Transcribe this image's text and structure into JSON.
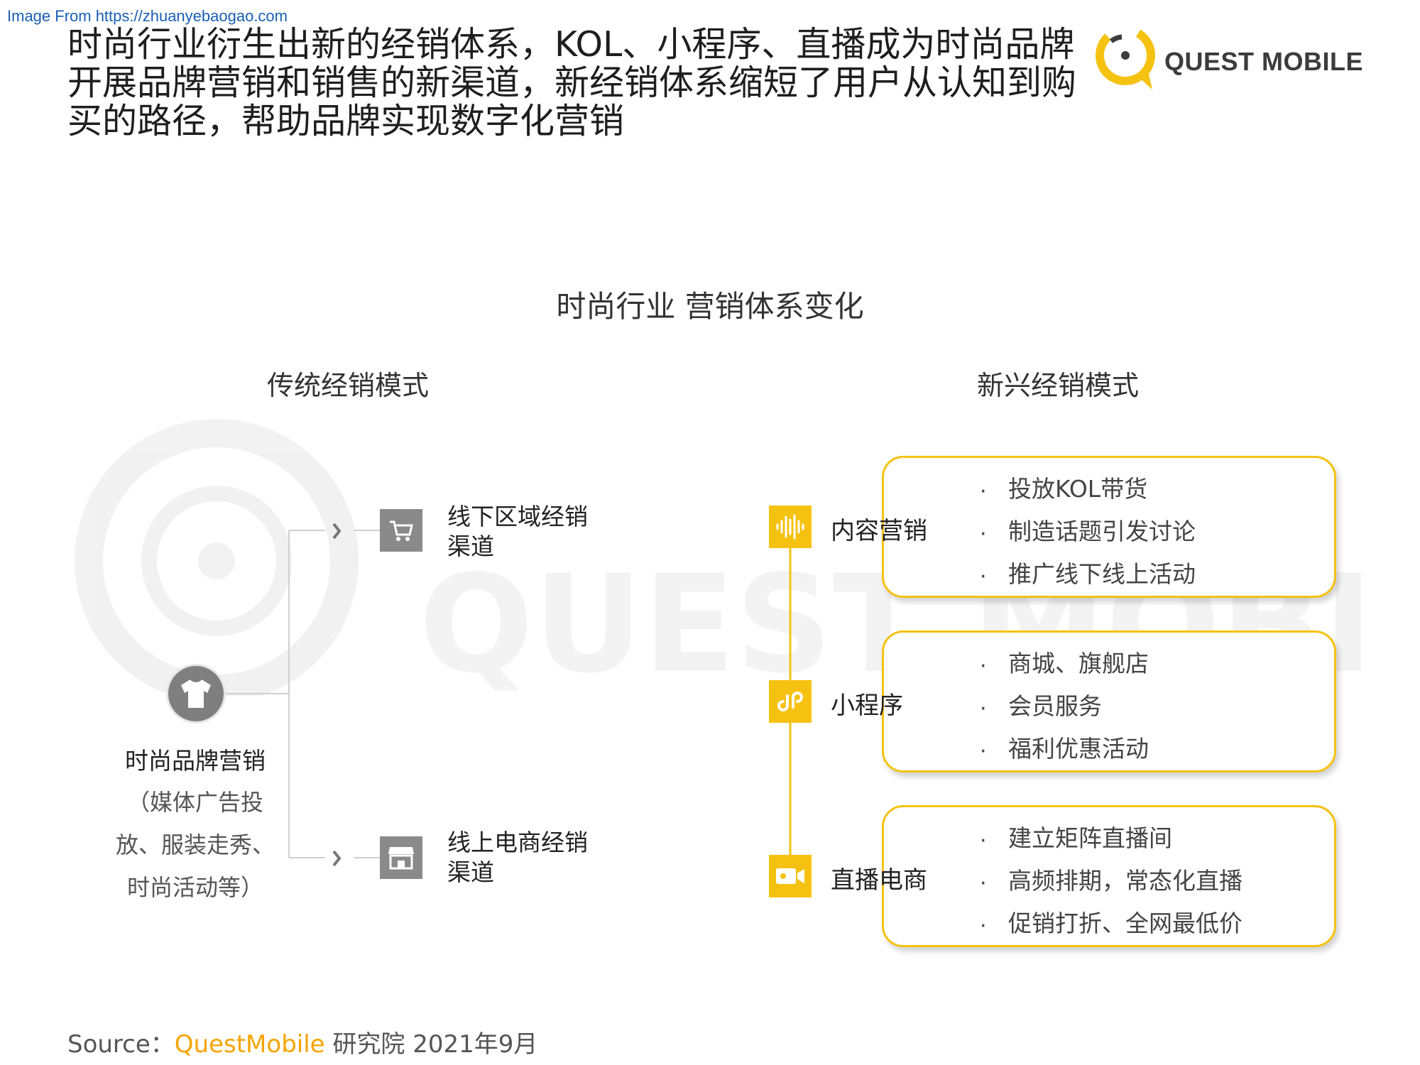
{
  "image_from": "Image From https://zhuanyebaogao.com",
  "headline": "时尚行业衍生出新的经销体系，KOL、小程序、直播成为时尚品牌开展品牌营销和销售的新渠道，新经销体系缩短了用户从认知到购买的路径，帮助品牌实现数字化营销",
  "logo_text": "QUEST MOBILE",
  "diagram_title": "时尚行业 营销体系变化",
  "traditional": {
    "title": "传统经销模式",
    "brand_title": "时尚品牌营销",
    "brand_desc": "（媒体广告投放、服装走秀、时尚活动等）",
    "channels": [
      {
        "label": "线下区域经销渠道",
        "icon": "shopping-cart-icon"
      },
      {
        "label": "线上电商经销渠道",
        "icon": "storefront-icon"
      }
    ]
  },
  "emerging": {
    "title": "新兴经销模式",
    "groups": [
      {
        "label": "内容营销",
        "icon": "sound-wave-icon",
        "items": [
          "投放KOL带货",
          "制造话题引发讨论",
          "推广线下线上活动"
        ]
      },
      {
        "label": "小程序",
        "icon": "mini-program-icon",
        "items": [
          "商城、旗舰店",
          "会员服务",
          "福利优惠活动"
        ]
      },
      {
        "label": "直播电商",
        "icon": "video-camera-icon",
        "items": [
          "建立矩阵直播间",
          "高频排期，常态化直播",
          "促销打折、全网最低价"
        ]
      }
    ]
  },
  "source": {
    "prefix": "Source：",
    "brand": "QuestMobile",
    "suffix": " 研究院 2021年9月"
  },
  "colors": {
    "accent": "#f5c211",
    "gray_icon": "#8a8a8a"
  }
}
